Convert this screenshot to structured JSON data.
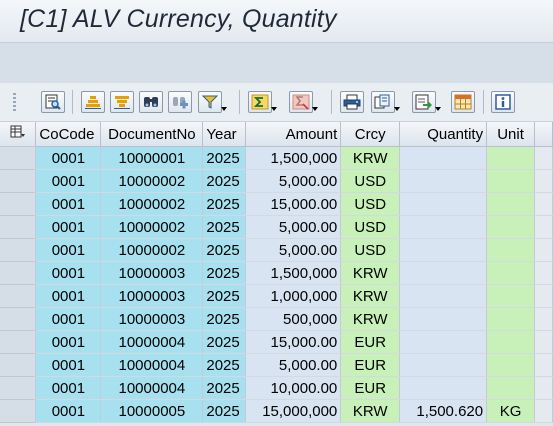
{
  "window": {
    "title": "[C1] ALV Currency, Quantity"
  },
  "toolbar": {
    "buttons": [
      {
        "icon": "details-icon"
      },
      {
        "icon": "sort-ascending-icon"
      },
      {
        "icon": "sort-descending-icon"
      },
      {
        "icon": "find-icon"
      },
      {
        "icon": "find-next-icon"
      },
      {
        "icon": "filter-icon"
      },
      {
        "icon": "sum-icon"
      },
      {
        "icon": "subtotal-icon"
      },
      {
        "icon": "print-icon"
      },
      {
        "icon": "views-icon"
      },
      {
        "icon": "export-icon"
      },
      {
        "icon": "layout-icon"
      },
      {
        "icon": "information-icon"
      }
    ]
  },
  "grid": {
    "columns": [
      "CoCode",
      "DocumentNo",
      "Year",
      "Amount",
      "Crcy",
      "Quantity",
      "Unit"
    ],
    "rows": [
      {
        "cocode": "0001",
        "docno": "10000001",
        "year": "2025",
        "amount": "1,500,000",
        "crcy": "KRW",
        "quantity": "",
        "unit": ""
      },
      {
        "cocode": "0001",
        "docno": "10000002",
        "year": "2025",
        "amount": "5,000.00",
        "crcy": "USD",
        "quantity": "",
        "unit": ""
      },
      {
        "cocode": "0001",
        "docno": "10000002",
        "year": "2025",
        "amount": "15,000.00",
        "crcy": "USD",
        "quantity": "",
        "unit": ""
      },
      {
        "cocode": "0001",
        "docno": "10000002",
        "year": "2025",
        "amount": "5,000.00",
        "crcy": "USD",
        "quantity": "",
        "unit": ""
      },
      {
        "cocode": "0001",
        "docno": "10000002",
        "year": "2025",
        "amount": "5,000.00",
        "crcy": "USD",
        "quantity": "",
        "unit": ""
      },
      {
        "cocode": "0001",
        "docno": "10000003",
        "year": "2025",
        "amount": "1,500,000",
        "crcy": "KRW",
        "quantity": "",
        "unit": ""
      },
      {
        "cocode": "0001",
        "docno": "10000003",
        "year": "2025",
        "amount": "1,000,000",
        "crcy": "KRW",
        "quantity": "",
        "unit": ""
      },
      {
        "cocode": "0001",
        "docno": "10000003",
        "year": "2025",
        "amount": "500,000",
        "crcy": "KRW",
        "quantity": "",
        "unit": ""
      },
      {
        "cocode": "0001",
        "docno": "10000004",
        "year": "2025",
        "amount": "15,000.00",
        "crcy": "EUR",
        "quantity": "",
        "unit": ""
      },
      {
        "cocode": "0001",
        "docno": "10000004",
        "year": "2025",
        "amount": "5,000.00",
        "crcy": "EUR",
        "quantity": "",
        "unit": ""
      },
      {
        "cocode": "0001",
        "docno": "10000004",
        "year": "2025",
        "amount": "10,000.00",
        "crcy": "EUR",
        "quantity": "",
        "unit": ""
      },
      {
        "cocode": "0001",
        "docno": "10000005",
        "year": "2025",
        "amount": "15,000,000",
        "crcy": "KRW",
        "quantity": "1,500.620",
        "unit": "KG"
      }
    ]
  },
  "colors": {
    "key_column": "#a7e1f0",
    "amount_column": "#d8e4f2",
    "currency_column": "#c7f1b8"
  }
}
